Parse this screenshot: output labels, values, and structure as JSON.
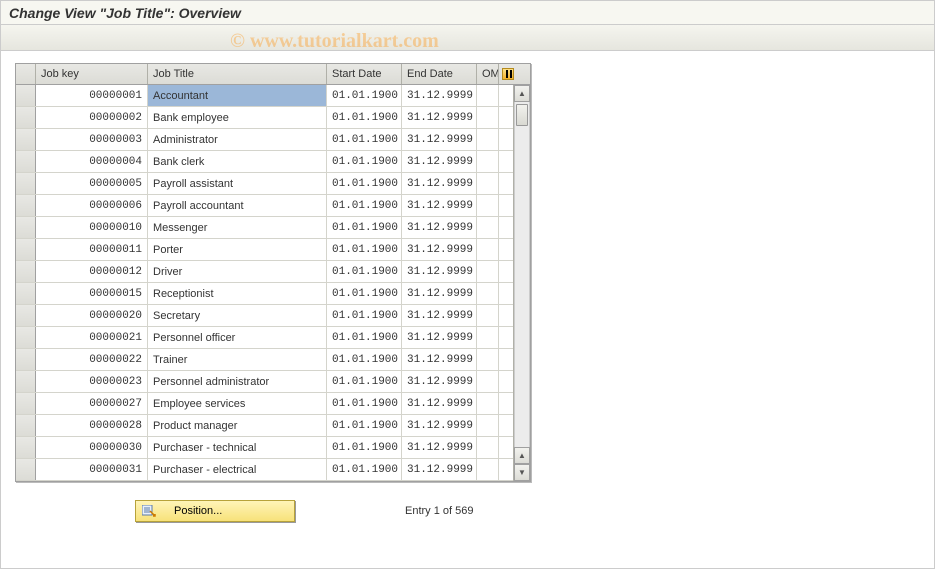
{
  "title": "Change View \"Job Title\": Overview",
  "watermark": "© www.tutorialkart.com",
  "columns": {
    "key": "Job key",
    "title": "Job Title",
    "start": "Start Date",
    "end": "End Date",
    "om": "OM"
  },
  "rows": [
    {
      "key": "00000001",
      "title": "Accountant",
      "start": "01.01.1900",
      "end": "31.12.9999",
      "om": "",
      "selected": true
    },
    {
      "key": "00000002",
      "title": "Bank employee",
      "start": "01.01.1900",
      "end": "31.12.9999",
      "om": ""
    },
    {
      "key": "00000003",
      "title": "Administrator",
      "start": "01.01.1900",
      "end": "31.12.9999",
      "om": ""
    },
    {
      "key": "00000004",
      "title": "Bank clerk",
      "start": "01.01.1900",
      "end": "31.12.9999",
      "om": ""
    },
    {
      "key": "00000005",
      "title": "Payroll assistant",
      "start": "01.01.1900",
      "end": "31.12.9999",
      "om": ""
    },
    {
      "key": "00000006",
      "title": "Payroll accountant",
      "start": "01.01.1900",
      "end": "31.12.9999",
      "om": ""
    },
    {
      "key": "00000010",
      "title": "Messenger",
      "start": "01.01.1900",
      "end": "31.12.9999",
      "om": ""
    },
    {
      "key": "00000011",
      "title": "Porter",
      "start": "01.01.1900",
      "end": "31.12.9999",
      "om": ""
    },
    {
      "key": "00000012",
      "title": "Driver",
      "start": "01.01.1900",
      "end": "31.12.9999",
      "om": ""
    },
    {
      "key": "00000015",
      "title": "Receptionist",
      "start": "01.01.1900",
      "end": "31.12.9999",
      "om": ""
    },
    {
      "key": "00000020",
      "title": "Secretary",
      "start": "01.01.1900",
      "end": "31.12.9999",
      "om": ""
    },
    {
      "key": "00000021",
      "title": "Personnel officer",
      "start": "01.01.1900",
      "end": "31.12.9999",
      "om": ""
    },
    {
      "key": "00000022",
      "title": "Trainer",
      "start": "01.01.1900",
      "end": "31.12.9999",
      "om": ""
    },
    {
      "key": "00000023",
      "title": "Personnel administrator",
      "start": "01.01.1900",
      "end": "31.12.9999",
      "om": ""
    },
    {
      "key": "00000027",
      "title": "Employee services",
      "start": "01.01.1900",
      "end": "31.12.9999",
      "om": ""
    },
    {
      "key": "00000028",
      "title": "Product manager",
      "start": "01.01.1900",
      "end": "31.12.9999",
      "om": ""
    },
    {
      "key": "00000030",
      "title": "Purchaser - technical",
      "start": "01.01.1900",
      "end": "31.12.9999",
      "om": ""
    },
    {
      "key": "00000031",
      "title": "Purchaser - electrical",
      "start": "01.01.1900",
      "end": "31.12.9999",
      "om": ""
    }
  ],
  "footer": {
    "position_label": "Position...",
    "entry_text": "Entry 1 of 569"
  }
}
